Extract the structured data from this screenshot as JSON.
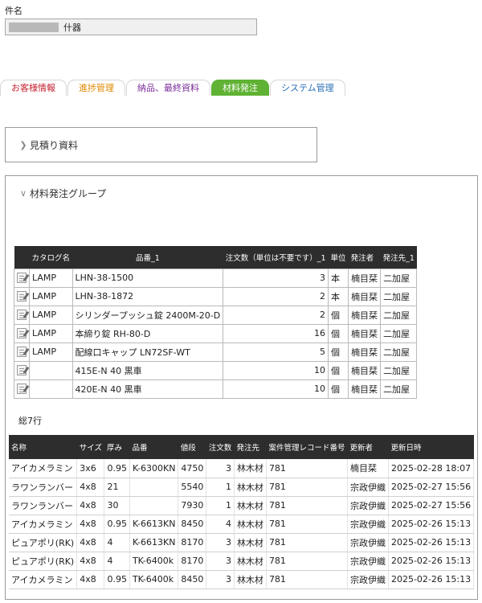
{
  "case": {
    "label": "件名",
    "value": "什器"
  },
  "tabs": [
    {
      "label": "お客様情報"
    },
    {
      "label": "進捗管理"
    },
    {
      "label": "納品、最終資料"
    },
    {
      "label": "材料発注"
    },
    {
      "label": "システム管理"
    }
  ],
  "estimate_panel": {
    "title": "見積り資料"
  },
  "order_panel": {
    "title": "材料発注グループ"
  },
  "colors": {
    "active_tab": "#5fb233",
    "header_bg": "#2d2d2d",
    "tab_red": "#c41e2c",
    "tab_orange": "#e08a00",
    "tab_purple": "#7a2c9a",
    "tab_blue": "#2a6fb5"
  },
  "orders": {
    "columns": [
      "",
      "カタログ名",
      "品番_1",
      "注文数（単位は不要です）_1",
      "単位",
      "発注者",
      "発注先_1"
    ],
    "rows": [
      {
        "icon": "edit-icon",
        "catalog": "LAMP",
        "part": "LHN-38-1500",
        "qty": "3",
        "unit": "本",
        "orderer": "楠目栞",
        "supplier": "二加屋"
      },
      {
        "icon": "edit-icon",
        "catalog": "LAMP",
        "part": "LHN-38-1872",
        "qty": "2",
        "unit": "本",
        "orderer": "楠目栞",
        "supplier": "二加屋"
      },
      {
        "icon": "edit-icon",
        "catalog": "LAMP",
        "part": "シリンダープッシュ錠 2400M-20-D",
        "qty": "2",
        "unit": "個",
        "orderer": "楠目栞",
        "supplier": "二加屋"
      },
      {
        "icon": "edit-icon",
        "catalog": "LAMP",
        "part": "本締り錠 RH-80-D",
        "qty": "16",
        "unit": "個",
        "orderer": "楠目栞",
        "supplier": "二加屋"
      },
      {
        "icon": "edit-icon",
        "catalog": "LAMP",
        "part": "配線口キャップ LN72SF-WT",
        "qty": "5",
        "unit": "個",
        "orderer": "楠目栞",
        "supplier": "二加屋"
      },
      {
        "icon": "edit-icon",
        "catalog": "",
        "part": "415E-N 40 黒車",
        "qty": "10",
        "unit": "個",
        "orderer": "楠目栞",
        "supplier": "二加屋"
      },
      {
        "icon": "edit-icon",
        "catalog": "",
        "part": "420E-N 40 黒車",
        "qty": "10",
        "unit": "個",
        "orderer": "楠目栞",
        "supplier": "二加屋"
      }
    ],
    "total_label": "総7行"
  },
  "materials": {
    "columns": [
      "名称",
      "サイズ",
      "厚み",
      "品番",
      "値段",
      "注文数",
      "発注先",
      "案件管理レコード番号",
      "更新者",
      "更新日時"
    ],
    "rows": [
      {
        "name": "アイカメラミン",
        "size": "3x6",
        "thick": "0.95",
        "part": "K-6300KN",
        "price": "4750",
        "qty": "3",
        "supplier": "林木材",
        "record": "781",
        "updater": "楠目栞",
        "updated": "2025-02-28 18:07"
      },
      {
        "name": "ラワンランバー",
        "size": "4x8",
        "thick": "21",
        "part": "",
        "price": "5540",
        "qty": "1",
        "supplier": "林木材",
        "record": "781",
        "updater": "宗政伊織",
        "updated": "2025-02-27 15:56"
      },
      {
        "name": "ラワンランバー",
        "size": "4x8",
        "thick": "30",
        "part": "",
        "price": "7930",
        "qty": "1",
        "supplier": "林木材",
        "record": "781",
        "updater": "宗政伊織",
        "updated": "2025-02-27 15:56"
      },
      {
        "name": "アイカメラミン",
        "size": "4x8",
        "thick": "0.95",
        "part": "K-6613KN",
        "price": "8450",
        "qty": "4",
        "supplier": "林木材",
        "record": "781",
        "updater": "宗政伊織",
        "updated": "2025-02-26 15:13"
      },
      {
        "name": "ピュアポリ(RK)",
        "size": "4x8",
        "thick": "4",
        "part": "K-6613KN",
        "price": "8170",
        "qty": "3",
        "supplier": "林木材",
        "record": "781",
        "updater": "宗政伊織",
        "updated": "2025-02-26 15:13"
      },
      {
        "name": "ピュアポリ(RK)",
        "size": "4x8",
        "thick": "4",
        "part": "TK-6400k",
        "price": "8170",
        "qty": "3",
        "supplier": "林木材",
        "record": "781",
        "updater": "宗政伊織",
        "updated": "2025-02-26 15:13"
      },
      {
        "name": "アイカメラミン",
        "size": "4x8",
        "thick": "0.95",
        "part": "TK-6400k",
        "price": "8450",
        "qty": "3",
        "supplier": "林木材",
        "record": "781",
        "updater": "宗政伊織",
        "updated": "2025-02-26 15:13"
      }
    ]
  }
}
